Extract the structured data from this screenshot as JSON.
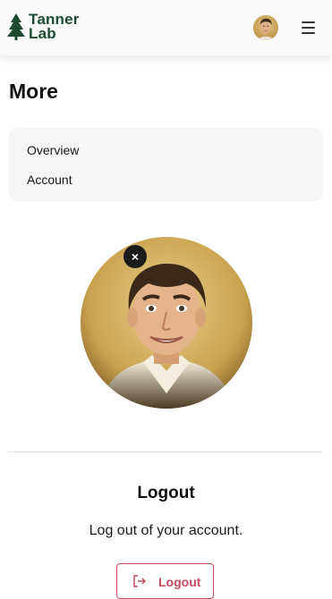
{
  "header": {
    "logo_line1": "Tanner",
    "logo_line2": "Lab",
    "logo_icon": "pine-tree-icon",
    "avatar_alt": "User avatar",
    "menu_icon": "hamburger-menu-icon",
    "brand_color": "#1e4a30"
  },
  "page": {
    "title": "More"
  },
  "nav": {
    "items": [
      {
        "label": "Overview"
      },
      {
        "label": "Account"
      }
    ]
  },
  "profile": {
    "image_alt": "Profile picture",
    "remove_icon": "close-icon",
    "remove_glyph": "×"
  },
  "logout": {
    "title": "Logout",
    "description": "Log out of your account.",
    "button_label": "Logout",
    "button_icon": "logout-icon",
    "accent_color": "#c44a5c"
  }
}
